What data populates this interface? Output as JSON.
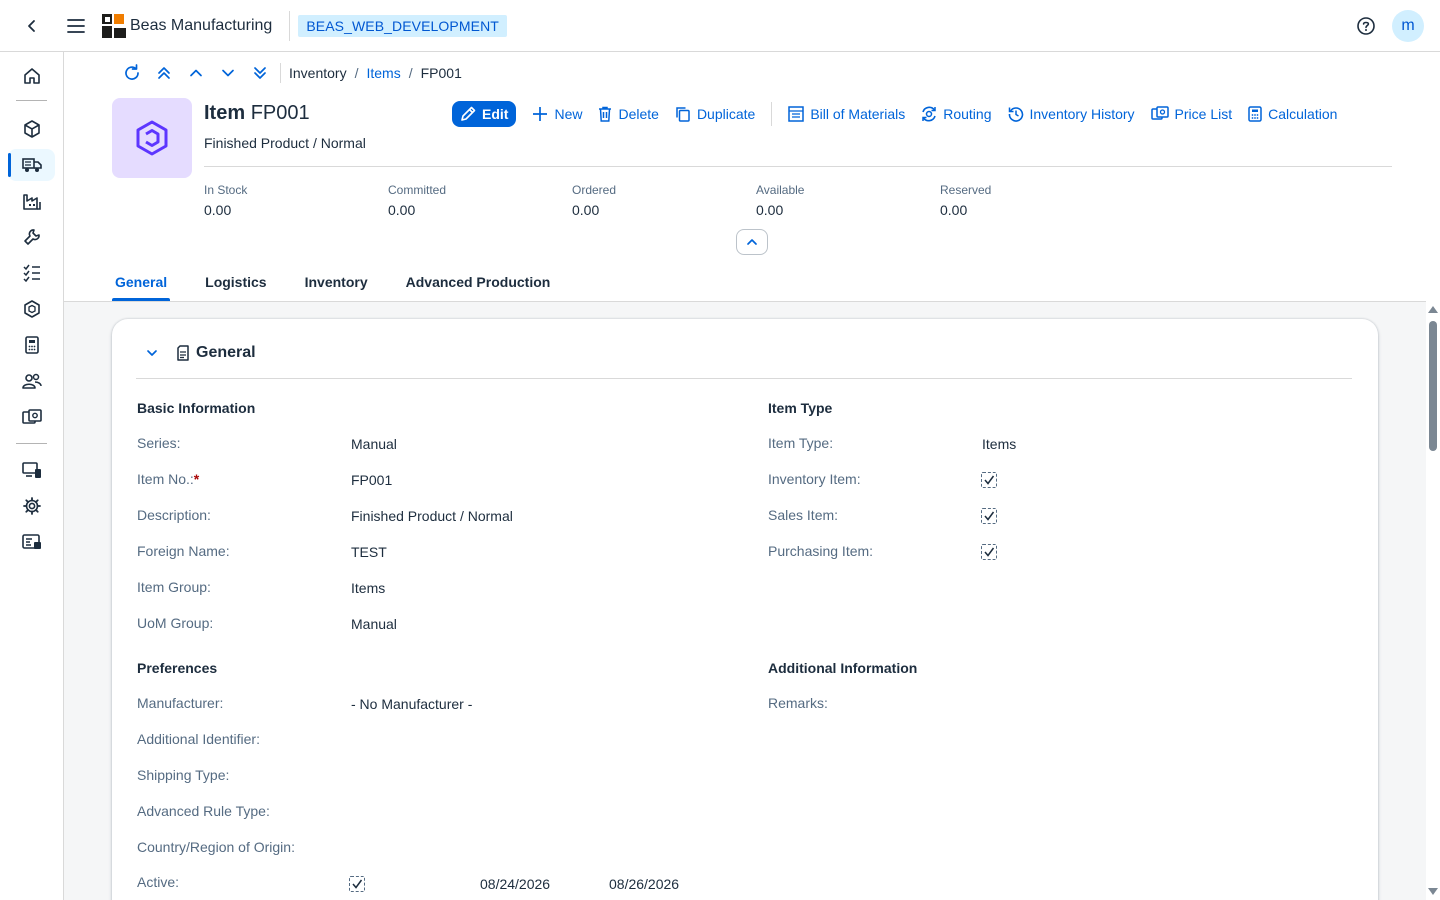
{
  "shell": {
    "app_title": "Beas Manufacturing",
    "system_badge": "BEAS_WEB_DEVELOPMENT",
    "user_initial": "m"
  },
  "sidebar": {
    "items": [
      {
        "icon": "home-icon"
      },
      {
        "icon": "cubes-icon"
      },
      {
        "icon": "truck-icon",
        "active": true
      },
      {
        "icon": "factory-icon"
      },
      {
        "icon": "wrench-icon"
      },
      {
        "icon": "checklist-icon"
      },
      {
        "icon": "hexagon-icon"
      },
      {
        "icon": "calculator-icon"
      },
      {
        "icon": "people-icon"
      },
      {
        "icon": "money-icon"
      },
      {
        "icon": "devices-icon"
      },
      {
        "icon": "settings-icon"
      },
      {
        "icon": "id-card-icon"
      }
    ]
  },
  "breadcrumb": {
    "root": "Inventory",
    "link": "Items",
    "current": "FP001",
    "separator": "/"
  },
  "object": {
    "title_prefix": "Item",
    "title_id": "FP001",
    "subtitle": "Finished Product / Normal",
    "icon": "item-hexagon-icon",
    "icon_bg": "#e5dcff",
    "icon_color": "#5d36ff"
  },
  "actions": {
    "edit": "Edit",
    "new": "New",
    "delete": "Delete",
    "duplicate": "Duplicate",
    "bom": "Bill of Materials",
    "routing": "Routing",
    "inventory_history": "Inventory History",
    "price_list": "Price List",
    "calculation": "Calculation"
  },
  "kpis": [
    {
      "label": "In Stock",
      "value": "0.00"
    },
    {
      "label": "Committed",
      "value": "0.00"
    },
    {
      "label": "Ordered",
      "value": "0.00"
    },
    {
      "label": "Available",
      "value": "0.00"
    },
    {
      "label": "Reserved",
      "value": "0.00"
    }
  ],
  "tabs": [
    "General",
    "Logistics",
    "Inventory",
    "Advanced Production"
  ],
  "active_tab": "General",
  "section": {
    "title": "General",
    "basic_info": {
      "title": "Basic Information",
      "fields": [
        {
          "label": "Series:",
          "value": "Manual"
        },
        {
          "label": "Item No.:",
          "value": "FP001",
          "required": "*"
        },
        {
          "label": "Description:",
          "value": "Finished Product / Normal"
        },
        {
          "label": "Foreign Name:",
          "value": "TEST"
        },
        {
          "label": "Item Group:",
          "value": "Items"
        },
        {
          "label": "UoM Group:",
          "value": "Manual"
        }
      ]
    },
    "item_type": {
      "title": "Item Type",
      "type_label": "Item Type:",
      "type_value": "Items",
      "checks": [
        {
          "label": "Inventory Item:",
          "checked": true
        },
        {
          "label": "Sales Item:",
          "checked": true
        },
        {
          "label": "Purchasing Item:",
          "checked": true
        }
      ]
    },
    "preferences": {
      "title": "Preferences",
      "manufacturer_label": "Manufacturer:",
      "manufacturer_value": "- No Manufacturer -",
      "additional_identifier_label": "Additional Identifier:",
      "shipping_type_label": "Shipping Type:",
      "advanced_rule_type_label": "Advanced Rule Type:",
      "country_label": "Country/Region of Origin:",
      "active_label": "Active:",
      "active_checked": true,
      "active_from": "08/24/2026",
      "active_to": "08/26/2026"
    },
    "additional_info": {
      "title": "Additional Information",
      "remarks_label": "Remarks:"
    }
  },
  "colors": {
    "accent": "#0064d9",
    "badge_bg": "#d1efff",
    "content_bg": "#f5f6f7",
    "required": "#aa0808"
  }
}
